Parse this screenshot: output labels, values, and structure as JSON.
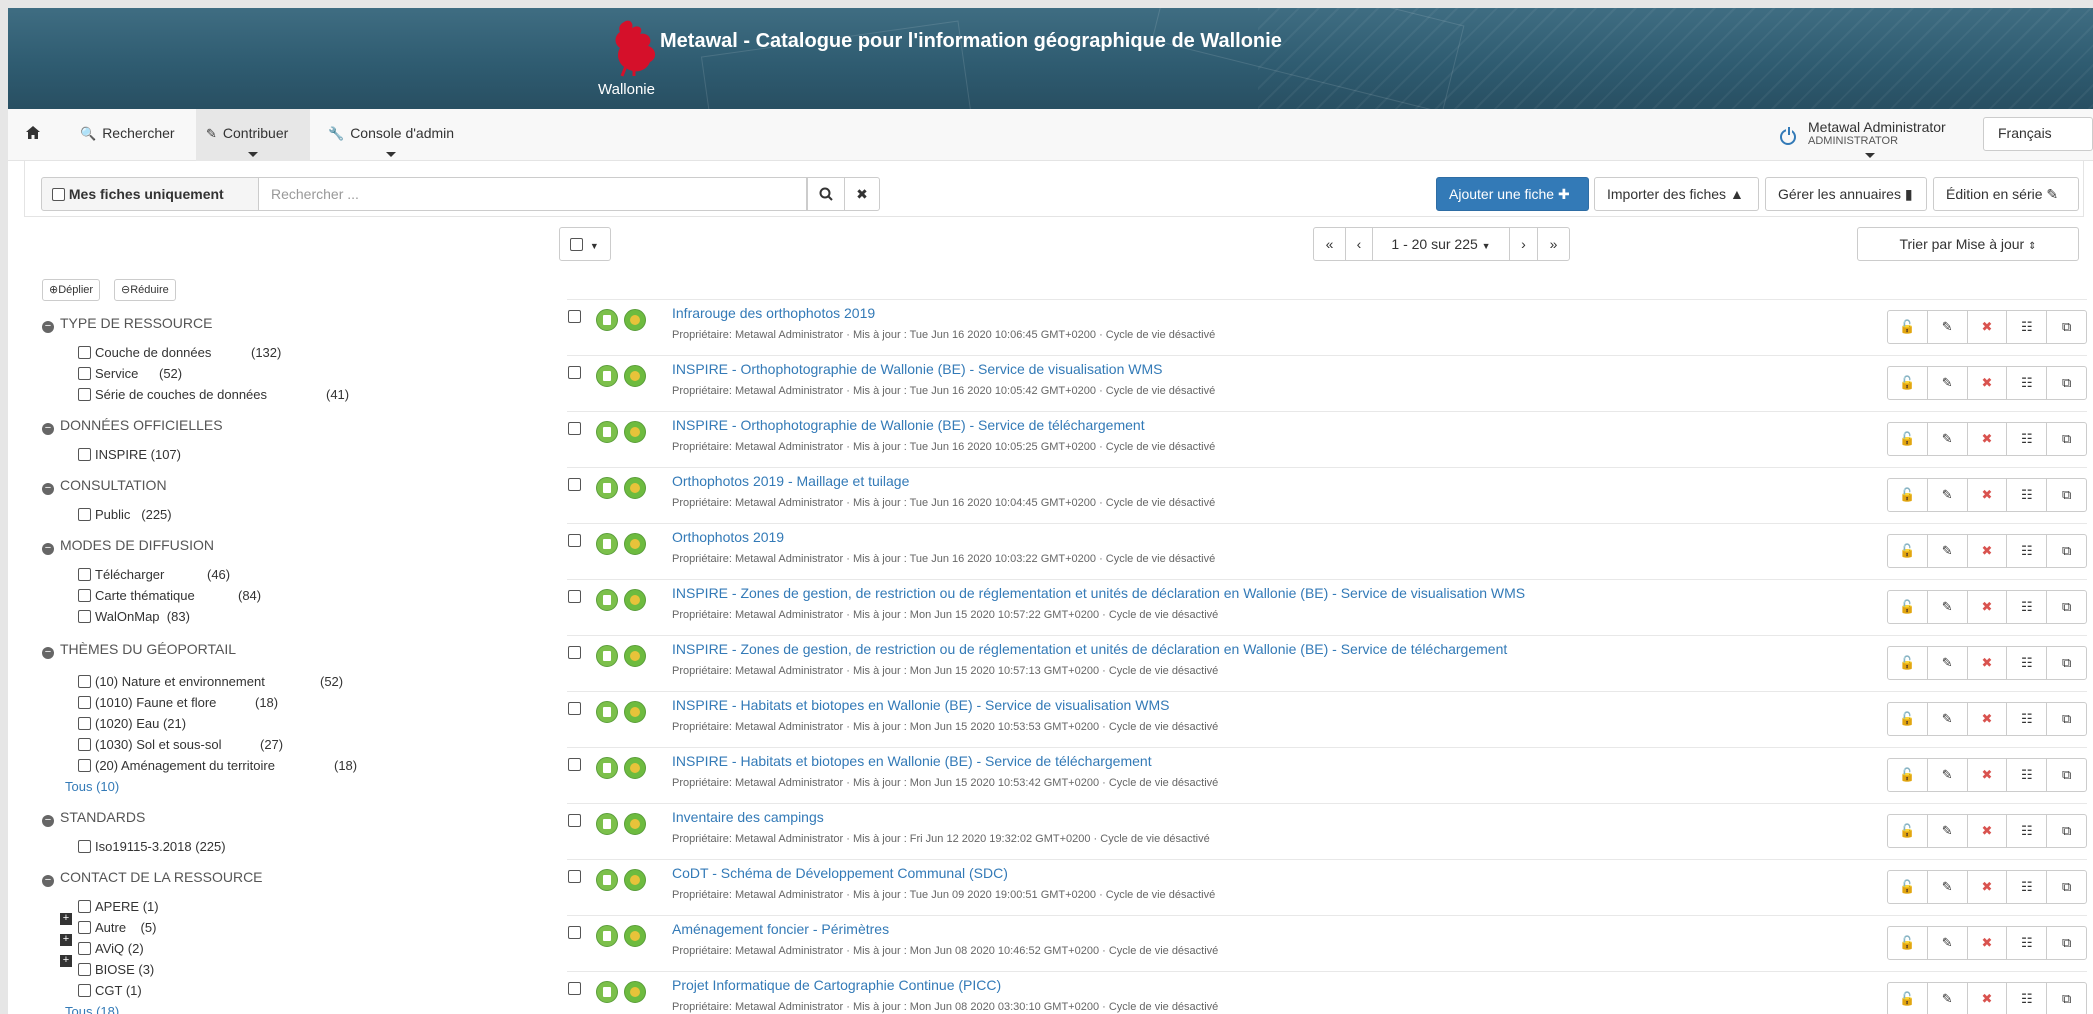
{
  "banner": {
    "title": "Metawal - Catalogue pour l'information géographique de Wallonie",
    "logo_text": "Wallonie"
  },
  "nav": {
    "home_icon": "home-icon",
    "search": "Rechercher",
    "contribute": "Contribuer",
    "admin": "Console d'admin",
    "user_name": "Metawal Administrator",
    "user_role": "ADMINISTRATOR",
    "language": "Français"
  },
  "toolbar": {
    "my_records": "Mes fiches uniquement",
    "search_placeholder": "Rechercher ...",
    "add_record": "Ajouter une fiche",
    "import_records": "Importer des fiches",
    "manage_directories": "Gérer les annuaires",
    "batch_edit": "Édition en série"
  },
  "list": {
    "pager_label": "1 - 20 sur 225",
    "sort_label": "Trier par Mise à jour"
  },
  "facets": {
    "expand": "Déplier",
    "collapse": "Réduire",
    "groups": [
      {
        "title": "TYPE DE RESSOURCE",
        "items": [
          {
            "label": "Couche de données",
            "count": "(132)"
          },
          {
            "label": "Service",
            "count": "(52)"
          },
          {
            "label": "Série de couches de données",
            "count": "(41)"
          }
        ]
      },
      {
        "title": "DONNÉES OFFICIELLES",
        "items": [
          {
            "label": "INSPIRE",
            "count": "(107)"
          }
        ]
      },
      {
        "title": "CONSULTATION",
        "items": [
          {
            "label": "Public",
            "count": "(225)"
          }
        ]
      },
      {
        "title": "MODES DE DIFFUSION",
        "items": [
          {
            "label": "Télécharger",
            "count": "(46)"
          },
          {
            "label": "Carte thématique",
            "count": "(84)"
          },
          {
            "label": "WalOnMap",
            "count": "(83)"
          }
        ]
      },
      {
        "title": "THÈMES DU GÉOPORTAIL",
        "items": [
          {
            "label": "(10) Nature et environnement",
            "count": "(52)"
          },
          {
            "label": "(1010) Faune et flore",
            "count": "(18)"
          },
          {
            "label": "(1020) Eau",
            "count": "(21)"
          },
          {
            "label": "(1030) Sol et sous-sol",
            "count": "(27)"
          },
          {
            "label": "(20) Aménagement du territoire",
            "count": "(18)"
          }
        ],
        "more": "Tous (10)"
      },
      {
        "title": "STANDARDS",
        "items": [
          {
            "label": "Iso19115-3.2018",
            "count": "(225)"
          }
        ]
      },
      {
        "title": "CONTACT DE LA RESSOURCE",
        "items": [
          {
            "label": "APERE",
            "count": "(1)"
          },
          {
            "label": "Autre",
            "count": "(5)"
          },
          {
            "label": "AViQ",
            "count": "(2)"
          },
          {
            "label": "BIOSE",
            "count": "(3)"
          },
          {
            "label": "CGT",
            "count": "(1)"
          }
        ],
        "more": "Tous (18)"
      }
    ]
  },
  "results": [
    {
      "title": "Infrarouge des orthophotos 2019",
      "meta": "Propriétaire: Metawal Administrator · Mis à jour : Tue Jun 16 2020 10:06:45 GMT+0200 · Cycle de vie désactivé"
    },
    {
      "title": "INSPIRE - Orthophotographie de Wallonie (BE) - Service de visualisation WMS",
      "meta": "Propriétaire: Metawal Administrator · Mis à jour : Tue Jun 16 2020 10:05:42 GMT+0200 · Cycle de vie désactivé"
    },
    {
      "title": "INSPIRE - Orthophotographie de Wallonie (BE) - Service de téléchargement",
      "meta": "Propriétaire: Metawal Administrator · Mis à jour : Tue Jun 16 2020 10:05:25 GMT+0200 · Cycle de vie désactivé"
    },
    {
      "title": "Orthophotos 2019 - Maillage et tuilage",
      "meta": "Propriétaire: Metawal Administrator · Mis à jour : Tue Jun 16 2020 10:04:45 GMT+0200 · Cycle de vie désactivé"
    },
    {
      "title": "Orthophotos 2019",
      "meta": "Propriétaire: Metawal Administrator · Mis à jour : Tue Jun 16 2020 10:03:22 GMT+0200 · Cycle de vie désactivé"
    },
    {
      "title": "INSPIRE - Zones de gestion, de restriction ou de réglementation et unités de déclaration en Wallonie (BE) - Service de visualisation WMS",
      "meta": "Propriétaire: Metawal Administrator · Mis à jour : Mon Jun 15 2020 10:57:22 GMT+0200 · Cycle de vie désactivé"
    },
    {
      "title": "INSPIRE - Zones de gestion, de restriction ou de réglementation et unités de déclaration en Wallonie (BE) - Service de téléchargement",
      "meta": "Propriétaire: Metawal Administrator · Mis à jour : Mon Jun 15 2020 10:57:13 GMT+0200 · Cycle de vie désactivé"
    },
    {
      "title": "INSPIRE - Habitats et biotopes en Wallonie (BE) - Service de visualisation WMS",
      "meta": "Propriétaire: Metawal Administrator · Mis à jour : Mon Jun 15 2020 10:53:53 GMT+0200 · Cycle de vie désactivé"
    },
    {
      "title": "INSPIRE - Habitats et biotopes en Wallonie (BE) - Service de téléchargement",
      "meta": "Propriétaire: Metawal Administrator · Mis à jour : Mon Jun 15 2020 10:53:42 GMT+0200 · Cycle de vie désactivé"
    },
    {
      "title": "Inventaire des campings",
      "meta": "Propriétaire: Metawal Administrator · Mis à jour : Fri Jun 12 2020 19:32:02 GMT+0200 · Cycle de vie désactivé"
    },
    {
      "title": "CoDT - Schéma de Développement Communal (SDC)",
      "meta": "Propriétaire: Metawal Administrator · Mis à jour : Tue Jun 09 2020 19:00:51 GMT+0200 · Cycle de vie désactivé"
    },
    {
      "title": "Aménagement foncier - Périmètres",
      "meta": "Propriétaire: Metawal Administrator · Mis à jour : Mon Jun 08 2020 10:46:52 GMT+0200 · Cycle de vie désactivé"
    },
    {
      "title": "Projet Informatique de Cartographie Continue (PICC)",
      "meta": "Propriétaire: Metawal Administrator · Mis à jour : Mon Jun 08 2020 03:30:10 GMT+0200 · Cycle de vie désactivé"
    }
  ]
}
